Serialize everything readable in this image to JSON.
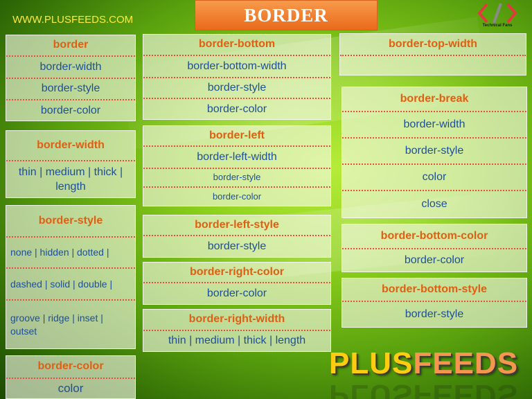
{
  "header": {
    "site": "WWW.PLUSFEEDS.COM",
    "title": "BORDER",
    "logo_caption": "Technical Fans",
    "logo_icon": "code-brackets-icon"
  },
  "brand": {
    "part1": "PLUS",
    "part2": "FEEDS"
  },
  "boxes": {
    "border": [
      "border",
      "border-width",
      "border-style",
      "border-color"
    ],
    "border_width": [
      "border-width",
      "thin | medium | thick | length"
    ],
    "border_style": [
      "border-style",
      "none | hidden | dotted |",
      "dashed | solid | double |",
      "groove | ridge | inset | outset"
    ],
    "border_color": [
      "border-color",
      "color"
    ],
    "border_bottom": [
      "border-bottom",
      "border-bottom-width",
      "border-style",
      "border-color"
    ],
    "border_left": [
      "border-left",
      "border-left-width",
      "border-style",
      "border-color"
    ],
    "border_left_style": [
      "border-left-style",
      "border-style"
    ],
    "border_right_color": [
      "border-right-color",
      "border-color"
    ],
    "border_right_width": [
      "border-right-width",
      "thin | medium | thick | length"
    ],
    "border_top_width": [
      "border-top-width"
    ],
    "border_break": [
      "border-break",
      "border-width",
      "border-style",
      "color",
      "close"
    ],
    "border_bottom_color": [
      "border-bottom-color",
      "border-color"
    ],
    "border_bottom_style": [
      "border-bottom-style",
      "border-style"
    ]
  },
  "colors": {
    "heading": "#e05f12",
    "value": "#1e4f98",
    "divider": "#ee4a3c",
    "title_bg": "#ea6a1a",
    "site": "#ffe93a",
    "brand_plus": "#ffcc10",
    "brand_feeds": "#f59650"
  }
}
